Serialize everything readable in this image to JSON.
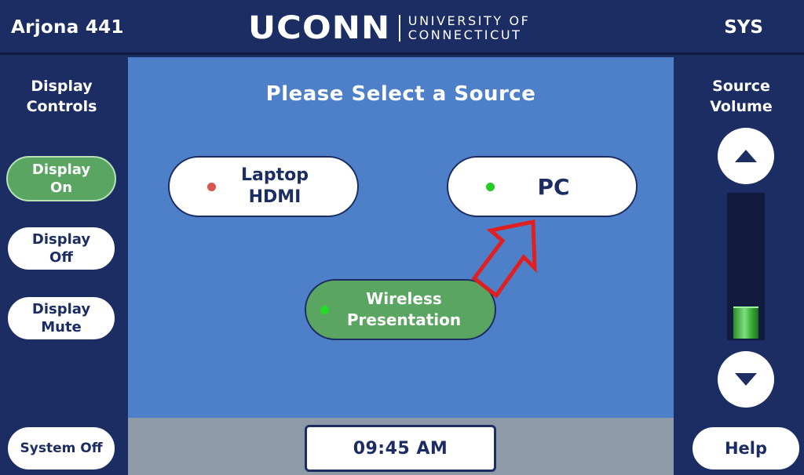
{
  "header": {
    "room_name": "Arjona 441",
    "logo_main": "UCONN",
    "logo_sub_line1": "UNIVERSITY OF",
    "logo_sub_line2": "CONNECTICUT",
    "sys_label": "SYS"
  },
  "left_sidebar": {
    "title_line1": "Display",
    "title_line2": "Controls",
    "buttons": [
      {
        "line1": "Display",
        "line2": "On",
        "active": true
      },
      {
        "line1": "Display",
        "line2": "Off",
        "active": false
      },
      {
        "line1": "Display",
        "line2": "Mute",
        "active": false
      }
    ],
    "system_off_label": "System Off"
  },
  "main": {
    "title": "Please Select a Source",
    "sources": [
      {
        "line1": "Laptop",
        "line2": "HDMI",
        "dot_color": "#d9534f",
        "selected": false
      },
      {
        "line1": "PC",
        "line2": "",
        "dot_color": "#22cc22",
        "selected": false
      },
      {
        "line1": "Wireless",
        "line2": "Presentation",
        "dot_color": "#22dd22",
        "selected": true
      }
    ]
  },
  "footer": {
    "time": "09:45 AM"
  },
  "right_sidebar": {
    "title_line1": "Source",
    "title_line2": "Volume",
    "volume_level_percent": 22,
    "up_icon": "triangle-up-icon",
    "down_icon": "triangle-down-icon",
    "help_label": "Help"
  },
  "colors": {
    "navy": "#1c2d63",
    "main_blue": "#4d80c8",
    "active_green": "#5aa561",
    "annotation_red": "#e02020"
  }
}
